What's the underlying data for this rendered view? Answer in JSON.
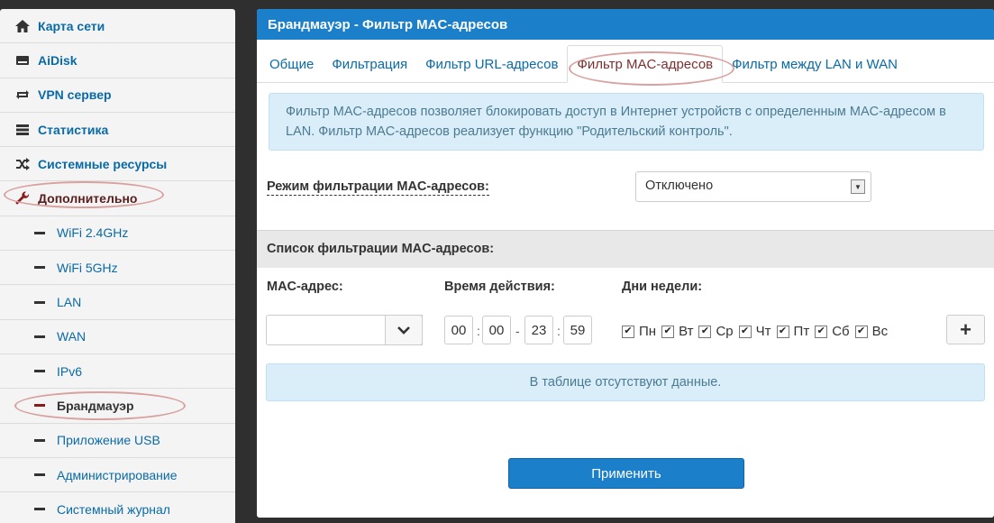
{
  "sidebar": {
    "items": [
      {
        "label": "Карта сети",
        "icon": "home-icon"
      },
      {
        "label": "AiDisk",
        "icon": "disk-icon"
      },
      {
        "label": "VPN сервер",
        "icon": "vpn-icon"
      },
      {
        "label": "Статистика",
        "icon": "list-icon"
      },
      {
        "label": "Системные ресурсы",
        "icon": "shuffle-icon"
      },
      {
        "label": "Дополнительно",
        "icon": "wrench-icon"
      }
    ],
    "subitems": [
      {
        "label": "WiFi 2.4GHz"
      },
      {
        "label": "WiFi 5GHz"
      },
      {
        "label": "LAN"
      },
      {
        "label": "WAN"
      },
      {
        "label": "IPv6"
      },
      {
        "label": "Брандмауэр"
      },
      {
        "label": "Приложение USB"
      },
      {
        "label": "Администрирование"
      },
      {
        "label": "Системный журнал"
      }
    ]
  },
  "main": {
    "title": "Брандмауэр - Фильтр MAC-адресов",
    "tabs": [
      {
        "label": "Общие"
      },
      {
        "label": "Фильтрация"
      },
      {
        "label": "Фильтр URL-адресов"
      },
      {
        "label": "Фильтр MAC-адресов"
      },
      {
        "label": "Фильтр между LAN и WAN"
      }
    ],
    "info": "Фильтр MAC-адресов позволяет блокировать доступ в Интернет устройств с определенным MAC-адресом в LAN. Фильтр MAC-адресов реализует функцию \"Родительский контроль\".",
    "mode_label": "Режим фильтрации MAC-адресов:",
    "mode_value": "Отключено",
    "list_title": "Список фильтрации MAC-адресов:",
    "col_mac": "MAC-адрес:",
    "col_time": "Время действия:",
    "col_days": "Дни недели:",
    "mac_value": "",
    "time": {
      "h1": "00",
      "m1": "00",
      "h2": "23",
      "m2": "59",
      "sep_colon": ":",
      "sep_dash": "-"
    },
    "days": [
      {
        "label": "Пн",
        "checked": true
      },
      {
        "label": "Вт",
        "checked": true
      },
      {
        "label": "Ср",
        "checked": true
      },
      {
        "label": "Чт",
        "checked": true
      },
      {
        "label": "Пт",
        "checked": true
      },
      {
        "label": "Сб",
        "checked": true
      },
      {
        "label": "Вс",
        "checked": true
      }
    ],
    "add_label": "+",
    "empty_text": "В таблице отсутствуют данные.",
    "apply_label": "Применить"
  },
  "colors": {
    "accent": "#1b7fc9",
    "link": "#0a6aa6",
    "info_bg": "#d9eef8",
    "highlight": "#d9a0a0"
  }
}
